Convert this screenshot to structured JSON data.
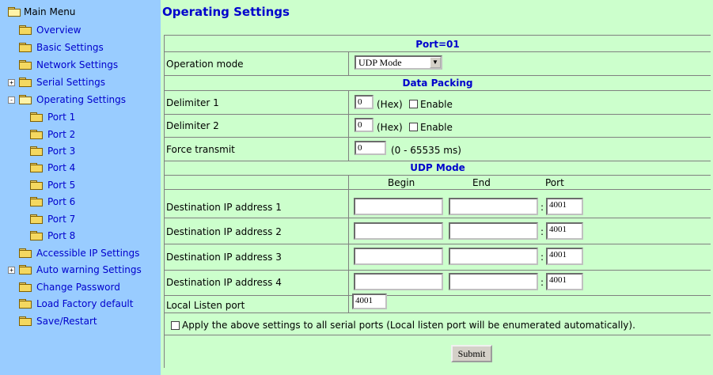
{
  "sidebar": {
    "root_label": "Main Menu",
    "items": [
      {
        "label": "Overview"
      },
      {
        "label": "Basic Settings"
      },
      {
        "label": "Network Settings"
      },
      {
        "label": "Serial Settings"
      },
      {
        "label": "Operating Settings"
      },
      {
        "label": "Port 1"
      },
      {
        "label": "Port 2"
      },
      {
        "label": "Port 3"
      },
      {
        "label": "Port 4"
      },
      {
        "label": "Port 5"
      },
      {
        "label": "Port 6"
      },
      {
        "label": "Port 7"
      },
      {
        "label": "Port 8"
      },
      {
        "label": "Accessible IP Settings"
      },
      {
        "label": "Auto warning Settings"
      },
      {
        "label": "Change Password"
      },
      {
        "label": "Load Factory default"
      },
      {
        "label": "Save/Restart"
      }
    ],
    "expand_marks": {
      "serial": "+",
      "operating": "-",
      "auto_warning": "+"
    }
  },
  "page": {
    "title": "Operating Settings"
  },
  "form": {
    "port_header": "Port=01",
    "operation_mode_label": "Operation mode",
    "operation_mode_value": "UDP Mode",
    "data_packing_header": "Data Packing",
    "delimiter1_label": "Delimiter 1",
    "delimiter1_value": "0",
    "delimiter2_label": "Delimiter 2",
    "delimiter2_value": "0",
    "hex_label": "(Hex)",
    "enable_label": "Enable",
    "force_transmit_label": "Force transmit",
    "force_transmit_value": "0",
    "force_transmit_range": "(0 - 65535 ms)",
    "udp_header": "UDP Mode",
    "col_begin": "Begin",
    "col_end": "End",
    "col_port": "Port",
    "destinations": [
      {
        "label": "Destination IP address 1",
        "begin": "",
        "end": "",
        "port": "4001"
      },
      {
        "label": "Destination IP address 2",
        "begin": "",
        "end": "",
        "port": "4001"
      },
      {
        "label": "Destination IP address 3",
        "begin": "",
        "end": "",
        "port": "4001"
      },
      {
        "label": "Destination IP address 4",
        "begin": "",
        "end": "",
        "port": "4001"
      }
    ],
    "colon": ":",
    "local_listen_label": "Local Listen port",
    "local_listen_value": "4001",
    "apply_all_label": "Apply the above settings to all serial ports (Local listen port will be enumerated automatically).",
    "submit_label": "Submit"
  },
  "colors": {
    "sidebar_bg": "#99ccff",
    "content_bg": "#ccffcc",
    "link": "#0000cc"
  }
}
